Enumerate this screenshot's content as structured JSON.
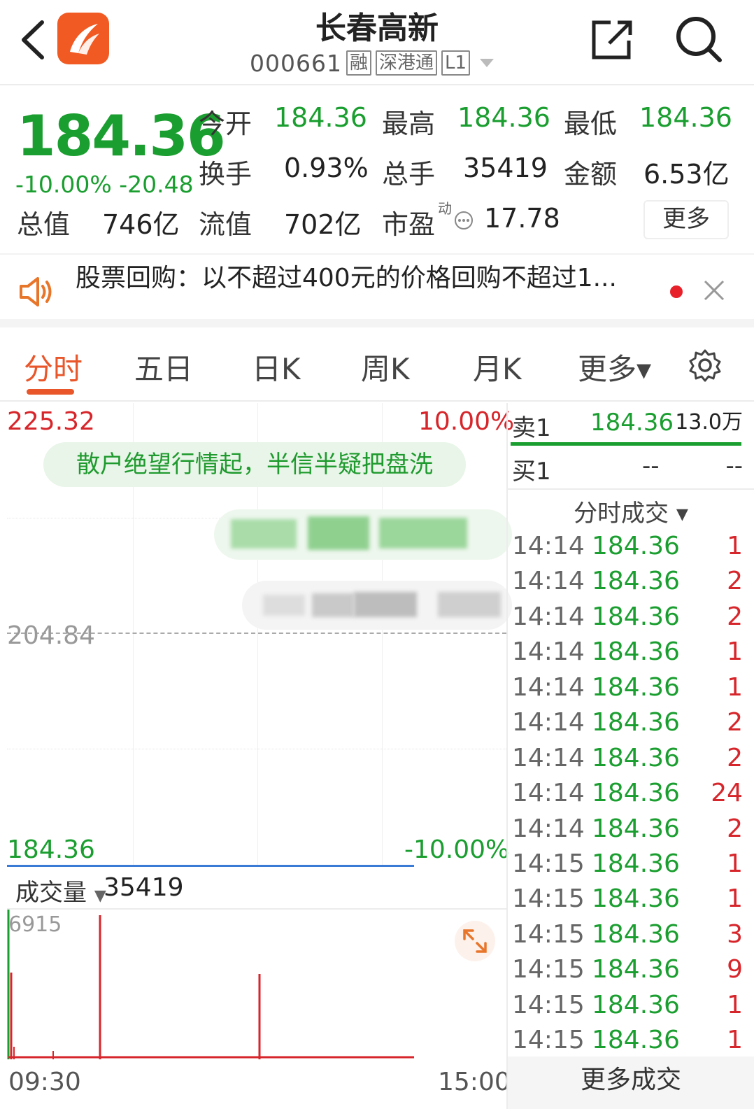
{
  "header": {
    "title": "长春高新",
    "code": "000661",
    "tags": [
      "融",
      "深港通",
      "L1"
    ]
  },
  "quote": {
    "price": "184.36",
    "change_pct": "-10.00%",
    "change_abs": "-20.48",
    "open_label": "今开",
    "open": "184.36",
    "high_label": "最高",
    "high": "184.36",
    "low_label": "最低",
    "low": "184.36",
    "turnover_label": "换手",
    "turnover": "0.93%",
    "volume_label": "总手",
    "volume": "35419",
    "amount_label": "金额",
    "amount": "6.53亿",
    "mcap_label": "总值",
    "mcap": "746亿",
    "float_label": "流值",
    "float_mcap": "702亿",
    "pe_label": "市盈",
    "pe_sup": "动",
    "pe": "17.78",
    "more_label": "更多"
  },
  "news": {
    "text": "股票回购：以不超过400元的价格回购不超过1..."
  },
  "tabs": [
    {
      "label": "分时"
    },
    {
      "label": "五日"
    },
    {
      "label": "日K"
    },
    {
      "label": "周K"
    },
    {
      "label": "月K"
    },
    {
      "label": "更多▾"
    }
  ],
  "chart": {
    "top_price": "225.32",
    "top_pct": "10.00%",
    "mid_price": "204.84",
    "bottom_price": "184.36",
    "bottom_pct": "-10.00%",
    "bubble": "散户绝望行情起，半信半疑把盘洗",
    "volume_label": "成交量",
    "volume_value": "35419",
    "volume_axis_max": "6915",
    "time_start": "09:30",
    "time_end": "15:00",
    "up_color": "#d7262b",
    "down_color": "#1a9e2f",
    "line_color": "#3a7bd5"
  },
  "orderbook": {
    "ask_label": "卖1",
    "ask_price": "184.36",
    "ask_vol": "13.0万",
    "bid_label": "买1",
    "bid_price": "--",
    "bid_vol": "--"
  },
  "ticks": {
    "header": "分时成交 ▾",
    "rows": [
      {
        "time": "14:14",
        "price": "184.36",
        "vol": "1"
      },
      {
        "time": "14:14",
        "price": "184.36",
        "vol": "2"
      },
      {
        "time": "14:14",
        "price": "184.36",
        "vol": "2"
      },
      {
        "time": "14:14",
        "price": "184.36",
        "vol": "1"
      },
      {
        "time": "14:14",
        "price": "184.36",
        "vol": "1"
      },
      {
        "time": "14:14",
        "price": "184.36",
        "vol": "2"
      },
      {
        "time": "14:14",
        "price": "184.36",
        "vol": "2"
      },
      {
        "time": "14:14",
        "price": "184.36",
        "vol": "24"
      },
      {
        "time": "14:14",
        "price": "184.36",
        "vol": "2"
      },
      {
        "time": "14:15",
        "price": "184.36",
        "vol": "1"
      },
      {
        "time": "14:15",
        "price": "184.36",
        "vol": "1"
      },
      {
        "time": "14:15",
        "price": "184.36",
        "vol": "3"
      },
      {
        "time": "14:15",
        "price": "184.36",
        "vol": "9"
      },
      {
        "time": "14:15",
        "price": "184.36",
        "vol": "1"
      },
      {
        "time": "14:15",
        "price": "184.36",
        "vol": "1"
      }
    ],
    "more_label": "更多成交"
  },
  "icons": {
    "back": "chevron-left-icon",
    "logo": "app-logo-icon",
    "share": "share-icon",
    "search": "search-icon",
    "speaker": "speaker-icon",
    "close": "close-icon",
    "settings": "gear-icon",
    "expand": "expand-icon"
  }
}
